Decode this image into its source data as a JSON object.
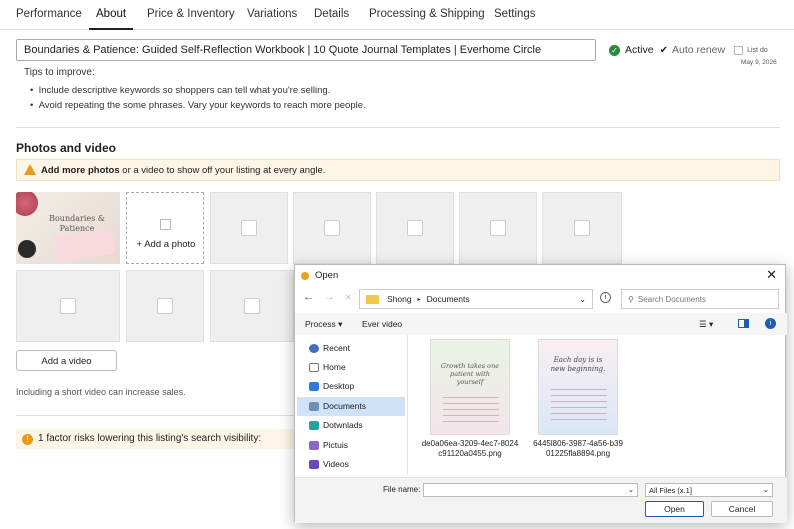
{
  "tabs": [
    "Performance",
    "About",
    "Price & Inventory",
    "Variations",
    "Details",
    "Processing & Shipping",
    "Settings"
  ],
  "active_tab": "About",
  "listing": {
    "title": "Boundaries & Patience: Guided Self-Reflection Workbook | 10 Quote Journal Templates | Everhome Circle",
    "active_label": "Active",
    "auto_renew_label": "Auto renew",
    "list_do_label": "List do",
    "list_date": "May 9, 2026"
  },
  "tips": {
    "heading": "Tips to improve:",
    "items": [
      "Include descriptive keywords so shoppers can tell what you're selling.",
      "Avoid repeating the some phrases. Vary your keywords to reach more people."
    ]
  },
  "photos": {
    "section_title": "Photos and video",
    "banner_bold": "Add more photos",
    "banner_rest": " or a video to show off your listing at every angle.",
    "thumb_text_line1": "Boundaries &",
    "thumb_text_line2": "Patience",
    "add_photo_label": "+ Add a photo",
    "add_video_label": "Add a video",
    "video_note": "Including a short video can increase sales."
  },
  "visibility_warning": "1 factor risks lowering this listing's search visibility:",
  "dialog": {
    "title": "Open",
    "path_parent": "Shong",
    "path_current": "Documents",
    "search_placeholder": "Search Documents",
    "process_label": "Process",
    "new_folder_label": "Ever video",
    "nav": [
      "Recent",
      "Home",
      "Desktop",
      "Documents",
      "Dotwnlads",
      "Pictuis",
      "Videos"
    ],
    "selected_nav": "Documents",
    "files": [
      {
        "name_line1": "de0a06ea-3209-4ec7-8024",
        "name_line2": "c91120a0455.png",
        "text": "Growth takes one patient with yourself"
      },
      {
        "name_line1": "6445l806-3987-4a56-b39",
        "name_line2": "01225fla8894.png",
        "text": "Each day is is new beginning."
      }
    ],
    "file_name_label": "File name:",
    "file_name_value": "",
    "file_type": "All Files (x.1]",
    "open_label": "Open",
    "cancel_label": "Cancel"
  }
}
